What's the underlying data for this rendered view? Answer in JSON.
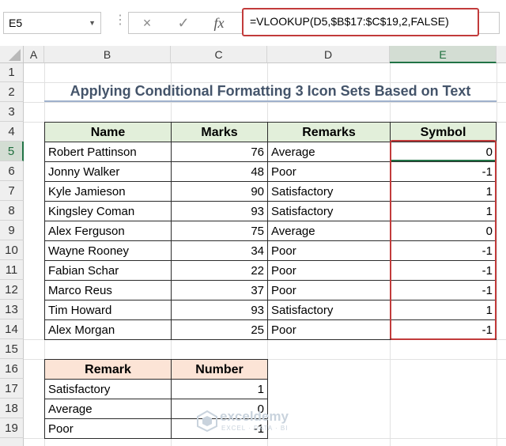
{
  "formula_bar": {
    "name_box": "E5",
    "cancel_icon": "×",
    "enter_icon": "✓",
    "fx_label": "fx",
    "formula": "=VLOOKUP(D5,$B$17:$C$19,2,FALSE)"
  },
  "columns": [
    "A",
    "B",
    "C",
    "D",
    "E"
  ],
  "rows": [
    "1",
    "2",
    "3",
    "4",
    "5",
    "6",
    "7",
    "8",
    "9",
    "10",
    "11",
    "12",
    "13",
    "14",
    "15",
    "16",
    "17",
    "18",
    "19"
  ],
  "title": "Applying Conditional Formatting 3 Icon Sets Based on Text",
  "main_table": {
    "headers": [
      "Name",
      "Marks",
      "Remarks",
      "Symbol"
    ],
    "rows": [
      {
        "name": "Robert Pattinson",
        "marks": "76",
        "remarks": "Average",
        "symbol": "0"
      },
      {
        "name": "Jonny Walker",
        "marks": "48",
        "remarks": "Poor",
        "symbol": "-1"
      },
      {
        "name": "Kyle Jamieson",
        "marks": "90",
        "remarks": "Satisfactory",
        "symbol": "1"
      },
      {
        "name": "Kingsley Coman",
        "marks": "93",
        "remarks": "Satisfactory",
        "symbol": "1"
      },
      {
        "name": "Alex Ferguson",
        "marks": "75",
        "remarks": "Average",
        "symbol": "0"
      },
      {
        "name": "Wayne Rooney",
        "marks": "34",
        "remarks": "Poor",
        "symbol": "-1"
      },
      {
        "name": "Fabian Schar",
        "marks": "22",
        "remarks": "Poor",
        "symbol": "-1"
      },
      {
        "name": "Marco Reus",
        "marks": "37",
        "remarks": "Poor",
        "symbol": "-1"
      },
      {
        "name": "Tim Howard",
        "marks": "93",
        "remarks": "Satisfactory",
        "symbol": "1"
      },
      {
        "name": "Alex Morgan",
        "marks": "25",
        "remarks": "Poor",
        "symbol": "-1"
      }
    ]
  },
  "lookup_table": {
    "headers": [
      "Remark",
      "Number"
    ],
    "rows": [
      {
        "remark": "Satisfactory",
        "number": "1"
      },
      {
        "remark": "Average",
        "number": "0"
      },
      {
        "remark": "Poor",
        "number": "-1"
      }
    ]
  },
  "watermark": {
    "name": "exceldemy",
    "tagline": "EXCEL · DATA · BI"
  },
  "colors": {
    "header_green": "#e2efda",
    "header_peach": "#fce4d6",
    "highlight_red": "#c23b3b",
    "excel_green": "#217346"
  }
}
